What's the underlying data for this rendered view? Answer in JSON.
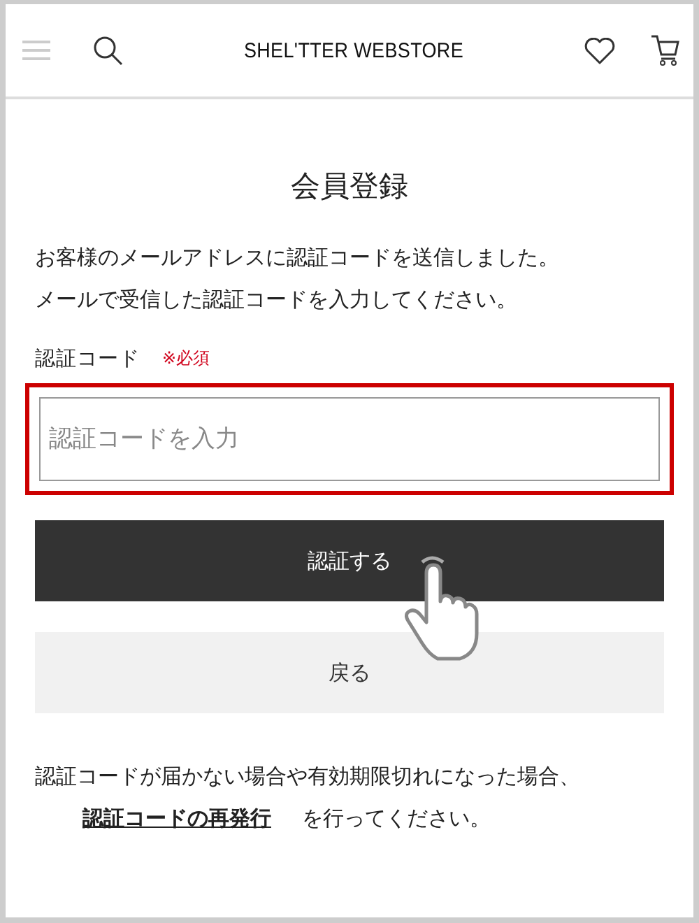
{
  "header": {
    "logo": "SHEL'TTER WEBSTORE"
  },
  "title": "会員登録",
  "intro": [
    "お客様のメールアドレスに認証コードを送信しました。",
    "メールで受信した認証コードを入力してください。"
  ],
  "field": {
    "label": "認証コード",
    "required": "※必須",
    "placeholder": "認証コードを入力",
    "highlighted": true
  },
  "buttons": [
    {
      "label": "認証する",
      "kind": "primary",
      "pointer": true
    },
    {
      "label": "戻る",
      "kind": "secondary",
      "pointer": false
    }
  ],
  "notice": {
    "before": "認証コードが届かない場合や有効期限切れになった場合、",
    "link": "認証コードの再発行",
    "after": "を行ってください。"
  }
}
